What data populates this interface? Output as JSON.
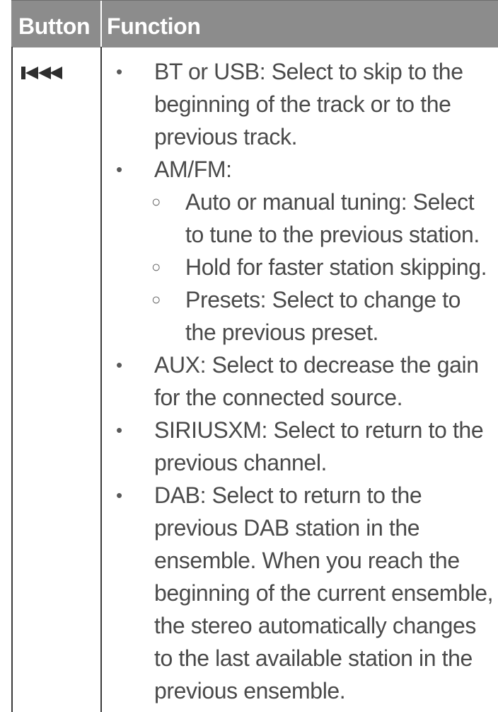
{
  "header": {
    "button": "Button",
    "function": "Function"
  },
  "icon": "previous-track-icon",
  "lines": {
    "l1": "BT or USB: Select to skip to the",
    "l2": "beginning of the track or to the",
    "l3": "previous track.",
    "l4": "AM/FM:",
    "l5": "Auto or manual tuning: Select",
    "l6": "to tune to the previous station.",
    "l7": "Hold for faster station skipping.",
    "l8": "Presets: Select to change to",
    "l9": "the previous preset.",
    "l10": "AUX: Select to decrease the gain",
    "l11": "for the connected source.",
    "l12": "SIRIUSXM: Select to return to the",
    "l13": "previous channel.",
    "l14": "DAB: Select to return to the",
    "l15": "previous DAB station in the",
    "l16": "ensemble. When you reach the",
    "l17": "beginning of the current ensemble,",
    "l18": "the stereo automatically changes",
    "l19": "to the last available station in the",
    "l20": "previous ensemble."
  },
  "markers": {
    "bullet": "•",
    "subbullet": "○"
  }
}
